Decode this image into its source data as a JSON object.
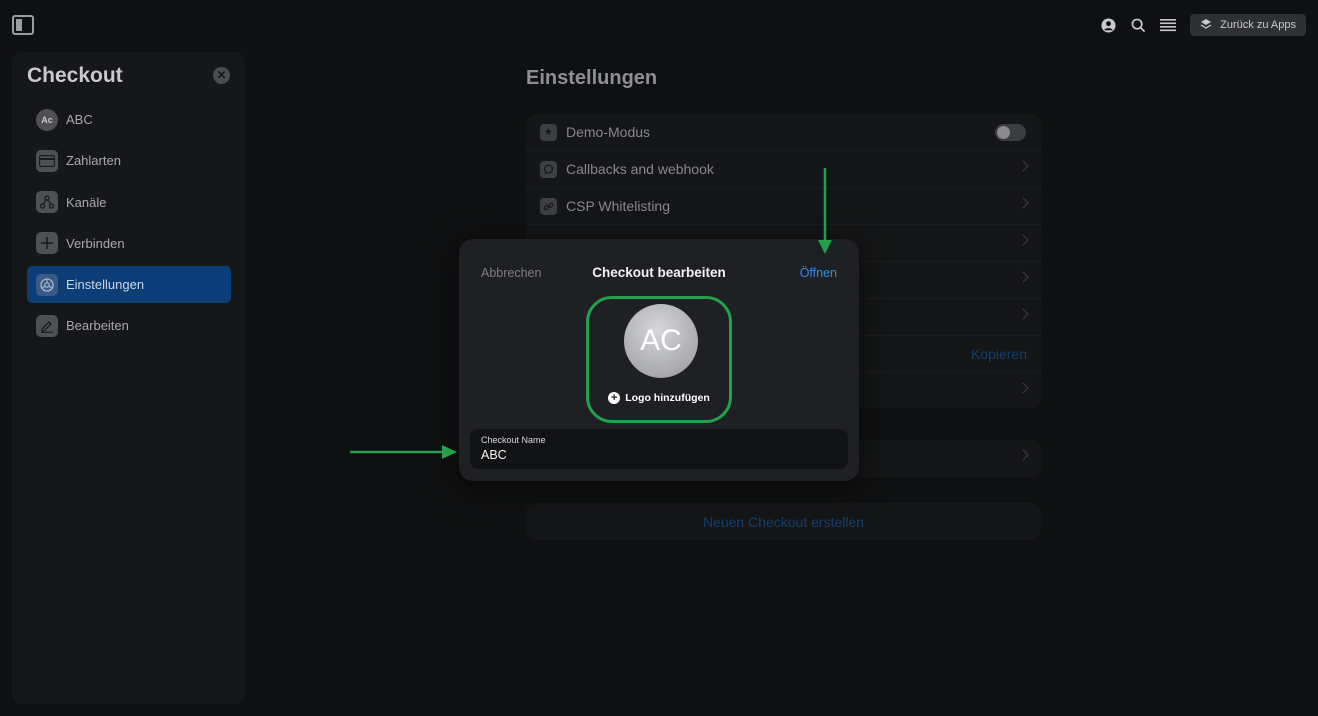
{
  "topbar": {
    "back_label": "Zurück zu Apps"
  },
  "sidebar": {
    "title": "Checkout",
    "items": [
      {
        "label": "ABC",
        "icon": "Ac",
        "active": false
      },
      {
        "label": "Zahlarten",
        "icon": "credit-card-icon",
        "active": false
      },
      {
        "label": "Kanäle",
        "icon": "channels-icon",
        "active": false
      },
      {
        "label": "Verbinden",
        "icon": "plus-icon",
        "active": false
      },
      {
        "label": "Einstellungen",
        "icon": "settings-icon",
        "active": true
      },
      {
        "label": "Bearbeiten",
        "icon": "edit-icon",
        "active": false
      }
    ]
  },
  "settings": {
    "title": "Einstellungen",
    "rows": [
      {
        "label": "Demo-Modus",
        "icon": "star-icon"
      },
      {
        "label": "Callbacks and webhook",
        "icon": "chat-icon"
      },
      {
        "label": "CSP Whitelisting",
        "icon": "link-icon"
      }
    ],
    "copy_label": "Kopieren",
    "create_label": "Neuen Checkout erstellen"
  },
  "modal": {
    "cancel_label": "Abbrechen",
    "title": "Checkout bearbeiten",
    "open_label": "Öffnen",
    "avatar_initials": "AC",
    "add_logo_label": "Logo hinzufügen",
    "field_label": "Checkout Name",
    "field_value": "ABC"
  },
  "colors": {
    "accent": "#2f8ae8",
    "highlight": "#22a04b",
    "active_nav": "#0c3d77"
  }
}
